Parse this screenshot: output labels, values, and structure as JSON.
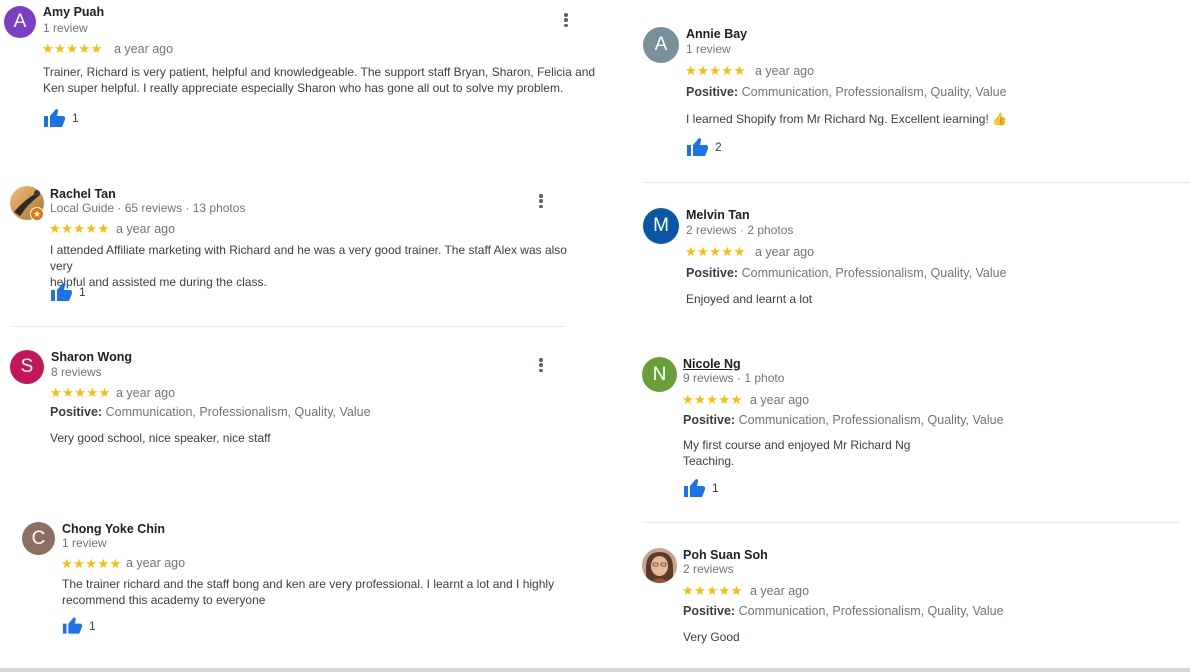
{
  "colors": {
    "accent_blue": "#1a73e8",
    "star": "#fbbc04",
    "secondary_text": "#70757a"
  },
  "reviews": {
    "amy": {
      "initial": "A",
      "avatar_color": "#7b3fc6",
      "name": "Amy Puah",
      "meta": "1 review",
      "stars": "★★★★★",
      "rating": 5,
      "time": "a year ago",
      "text": "Trainer, Richard is very patient, helpful and knowledgeable. The support staff Bryan, Sharon, Felicia and\nKen super helpful. I really appreciate especially Sharon who has gone all out to solve my problem.",
      "likes": "1"
    },
    "rachel": {
      "name": "Rachel Tan",
      "meta": "Local Guide · 65 reviews · 13 photos",
      "stars": "★★★★★",
      "rating": 5,
      "time": "a year ago",
      "text": "I attended Affiliate marketing with Richard and he was a very good trainer. The staff Alex was also very\nhelpful and assisted me during the class.",
      "likes": "1"
    },
    "sharon": {
      "initial": "S",
      "avatar_color": "#c2185b",
      "name": "Sharon Wong",
      "meta": "8 reviews",
      "stars": "★★★★★",
      "rating": 5,
      "time": "a year ago",
      "positive_label": "Positive:",
      "positive_items": "Communication, Professionalism, Quality, Value",
      "text": "Very good school,  nice speaker,  nice staff"
    },
    "chong": {
      "initial": "C",
      "avatar_color": "#8d6e63",
      "name": "Chong Yoke Chin",
      "meta": "1 review",
      "stars": "★★★★★",
      "rating": 5,
      "time": "a year ago",
      "text": "The trainer richard and the staff bong and ken are very professional. I learnt a lot and I highly\nrecommend this academy to everyone",
      "likes": "1"
    },
    "annie": {
      "initial": "A",
      "avatar_color": "#78909c",
      "name": "Annie Bay",
      "meta": "1 review",
      "stars": "★★★★★",
      "rating": 5,
      "time": "a year ago",
      "positive_label": "Positive:",
      "positive_items": "Communication, Professionalism, Quality, Value",
      "text": "I learned Shopify from Mr Richard Ng. Excellent iearning! 👍",
      "likes": "2"
    },
    "melvin": {
      "initial": "M",
      "avatar_color": "#0b57a4",
      "name": "Melvin Tan",
      "meta": "2 reviews · 2 photos",
      "stars": "★★★★★",
      "rating": 5,
      "time": "a year ago",
      "positive_label": "Positive:",
      "positive_items": "Communication, Professionalism, Quality, Value",
      "text": "Enjoyed and learnt a lot"
    },
    "nicole": {
      "initial": "N",
      "avatar_color": "#689f38",
      "name": "Nicole Ng",
      "meta": "9 reviews · 1 photo",
      "stars": "★★★★★",
      "rating": 5,
      "time": "a year ago",
      "positive_label": "Positive:",
      "positive_items": "Communication, Professionalism, Quality, Value",
      "text": "My first course and enjoyed Mr Richard Ng\nTeaching.",
      "likes": "1"
    },
    "poh": {
      "name": "Poh Suan Soh",
      "meta": "2 reviews",
      "stars": "★★★★★",
      "rating": 5,
      "time": "a year ago",
      "positive_label": "Positive:",
      "positive_items": "Communication, Professionalism, Quality, Value",
      "text": "Very Good"
    }
  }
}
